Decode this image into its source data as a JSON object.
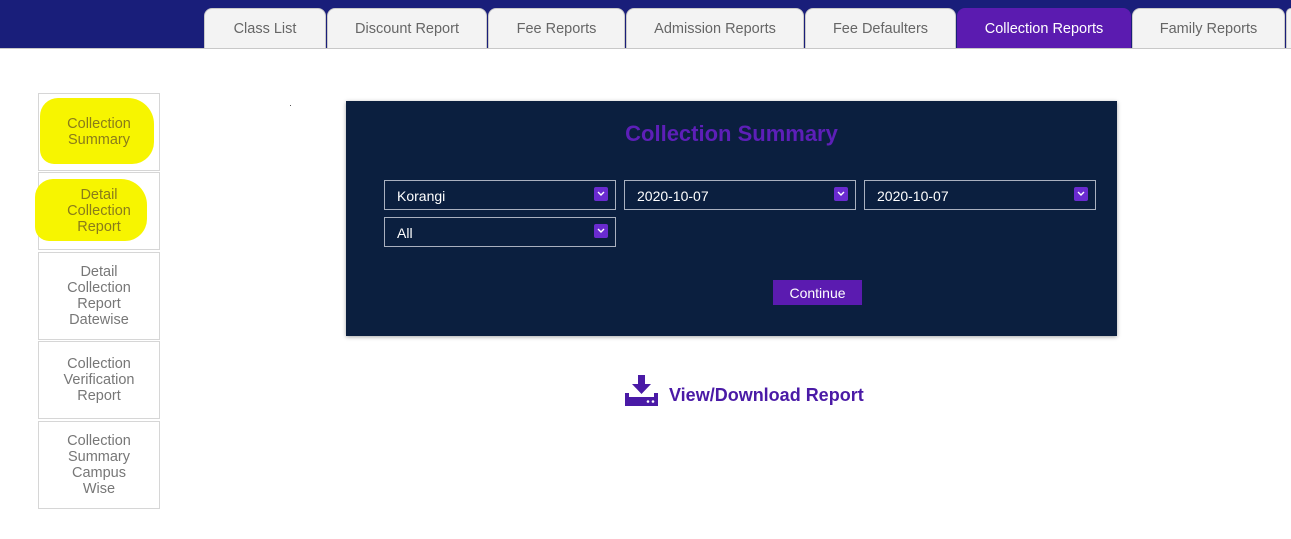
{
  "nav": {
    "tabs": [
      {
        "label": "Class List",
        "active": false
      },
      {
        "label": "Discount Report",
        "active": false
      },
      {
        "label": "Fee Reports",
        "active": false
      },
      {
        "label": "Admission Reports",
        "active": false
      },
      {
        "label": "Fee Defaulters",
        "active": false
      },
      {
        "label": "Collection Reports",
        "active": true
      },
      {
        "label": "Family Reports",
        "active": false
      }
    ]
  },
  "sidebar": {
    "items": [
      {
        "label": "Collection Summary",
        "highlighted": true
      },
      {
        "label": "Detail Collection Report",
        "highlighted": true
      },
      {
        "label": "Detail Collection Report Datewise",
        "highlighted": false
      },
      {
        "label": "Collection Verification Report",
        "highlighted": false
      },
      {
        "label": "Collection Summary Campus Wise",
        "highlighted": false
      }
    ]
  },
  "form": {
    "title": "Collection Summary",
    "campus": "Korangi",
    "date_from": "2020-10-07",
    "date_to": "2020-10-07",
    "filter": "All",
    "continue_label": "Continue"
  },
  "download": {
    "label": "View/Download Report",
    "icon": "download-icon"
  },
  "colors": {
    "topbar": "#191e7a",
    "accent": "#5b1bb0",
    "panel": "#0b1f3f",
    "highlight": "#f7f500"
  }
}
